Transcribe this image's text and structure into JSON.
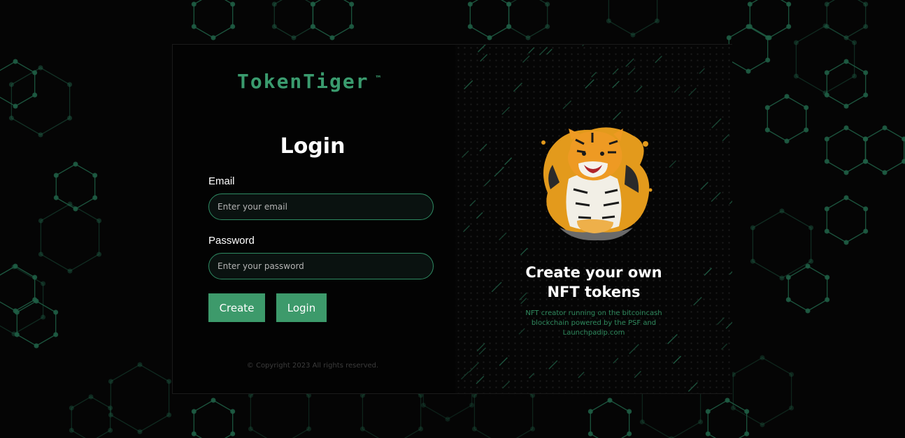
{
  "brand": {
    "name": "TokenTiger",
    "trademark": "™"
  },
  "login": {
    "title": "Login",
    "email_label": "Email",
    "email_placeholder": "Enter your email",
    "email_value": "",
    "password_label": "Password",
    "password_placeholder": "Enter your password",
    "password_value": "",
    "create_label": "Create",
    "login_label": "Login"
  },
  "footer": {
    "copyright": "© Copyright 2023 All rights reserved."
  },
  "promo": {
    "heading_line1": "Create your own",
    "heading_line2": "NFT tokens",
    "description": "NFT creator running on the bitcoincash blockchain powered by the PSF and Launchpadip.com"
  },
  "images": {
    "mascot": "tiger-mascot-illustration"
  },
  "colors": {
    "accent": "#3d9a6b",
    "brand_text": "#3a9b6e",
    "background": "#050505",
    "input_border": "#2e8a62",
    "hex_pattern": "#1f5e45",
    "rain": "#1f5a42"
  }
}
